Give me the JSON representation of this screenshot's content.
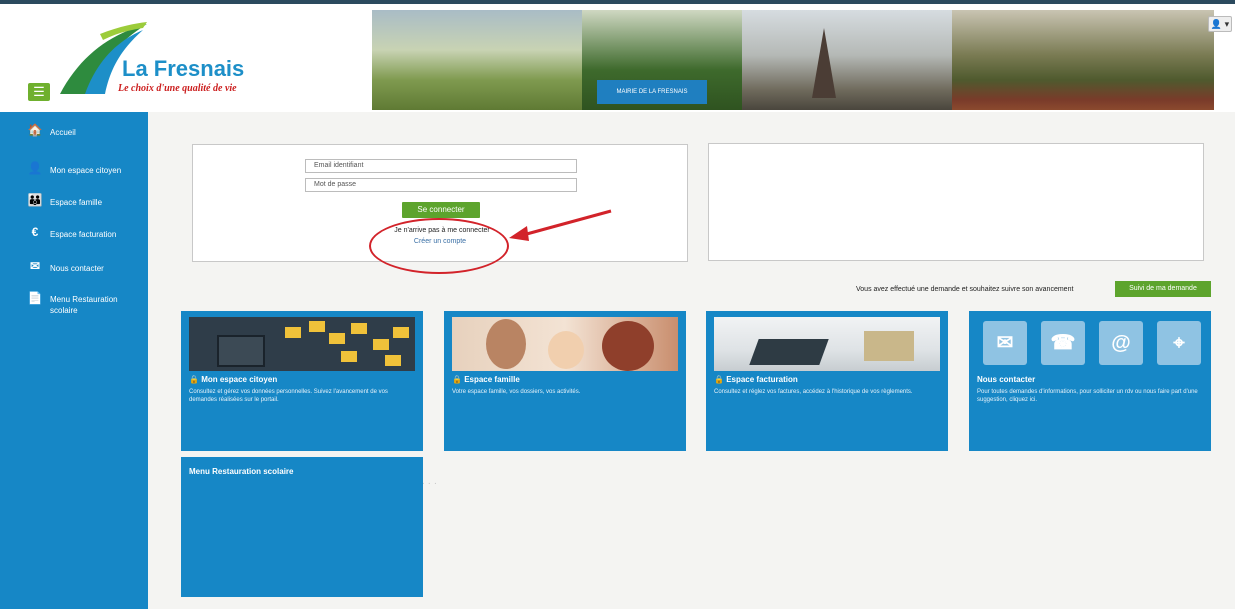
{
  "logo": {
    "title": "La Fresnais",
    "tagline": "Le choix d'une qualité de vie"
  },
  "banner": {
    "sign_text": "MAIRIE DE LA FRESNAIS"
  },
  "header": {
    "menu_icon": "☰",
    "user_label": "👤 ▾"
  },
  "sidebar": {
    "items": [
      {
        "icon": "🏠",
        "icon_name": "home-icon",
        "label": "Accueil"
      },
      {
        "icon": "👤",
        "icon_name": "user-icon",
        "label": "Mon espace citoyen"
      },
      {
        "icon": "👪",
        "icon_name": "family-icon",
        "label": "Espace famille"
      },
      {
        "icon": "€",
        "icon_name": "euro-icon",
        "label": "Espace facturation"
      },
      {
        "icon": "✉",
        "icon_name": "envelope-icon",
        "label": "Nous contacter"
      },
      {
        "icon": "📄",
        "icon_name": "menu-doc-icon",
        "label": "Menu Restauration scolaire"
      }
    ]
  },
  "login": {
    "email_placeholder": "Email identifiant",
    "password_placeholder": "Mot de passe",
    "submit_label": "Se connecter",
    "trouble_text": "Je n'arrive pas à me connecter",
    "create_account_label": "Créer un compte"
  },
  "follow": {
    "text": "Vous avez effectué une demande et souhaitez suivre son avancement",
    "button_label": "Suivi de ma demande"
  },
  "cards": [
    {
      "title": "Mon espace citoyen",
      "desc": "Consultez et gérez vos données personnelles. Suivez l'avancement de vos demandes réalisées sur le portail."
    },
    {
      "title": "Espace famille",
      "desc": "Votre espace famille, vos dossiers, vos activités."
    },
    {
      "title": "Espace facturation",
      "desc": "Consultez et réglez vos factures, accédez à l'historique de vos règlements."
    },
    {
      "title": "Nous contacter",
      "desc": "Pour toutes demandes d'informations, pour solliciter un rdv ou nous faire part d'une suggestion, cliquez ici."
    },
    {
      "title": "Menu Restauration scolaire",
      "desc": ""
    }
  ],
  "colors": {
    "primary": "#1687c6",
    "accent_green": "#5da42d",
    "annotation_red": "#d2232a"
  }
}
